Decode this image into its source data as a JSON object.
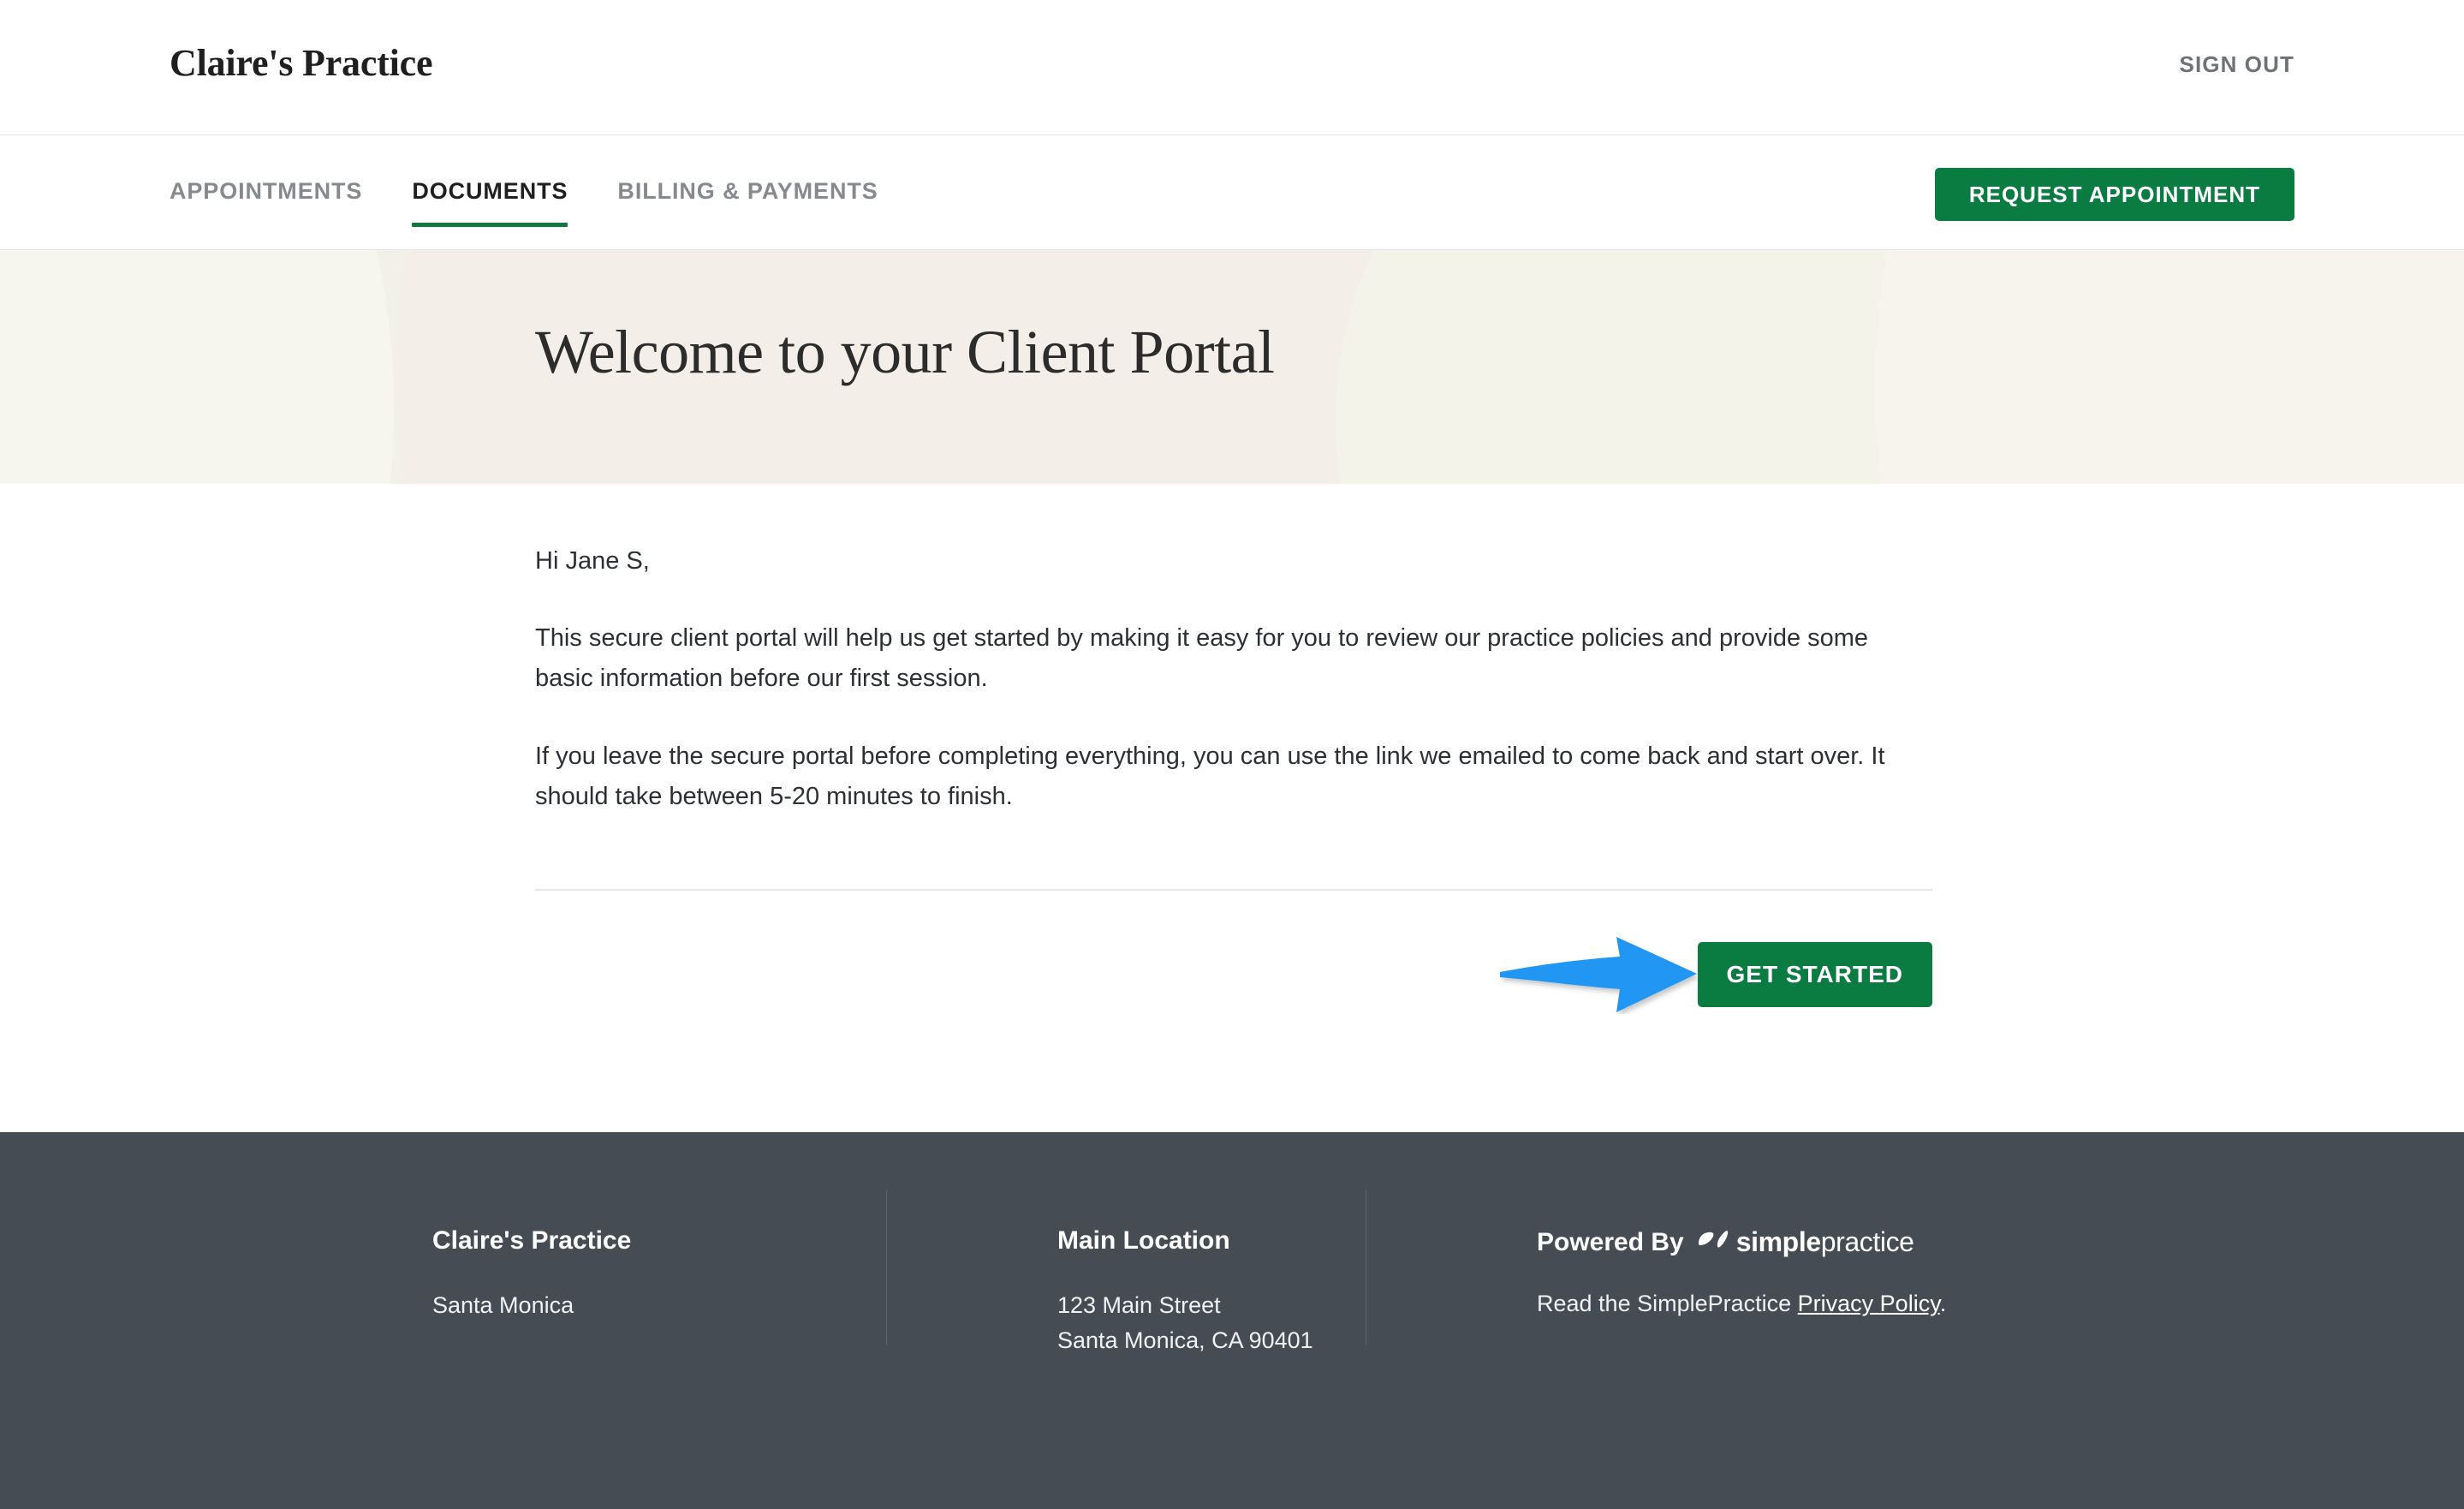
{
  "header": {
    "brand": "Claire's Practice",
    "sign_out_label": "SIGN OUT"
  },
  "nav": {
    "items": [
      {
        "label": "APPOINTMENTS",
        "active": false
      },
      {
        "label": "DOCUMENTS",
        "active": true
      },
      {
        "label": "BILLING & PAYMENTS",
        "active": false
      }
    ],
    "request_appointment_label": "REQUEST APPOINTMENT"
  },
  "hero": {
    "title": "Welcome to your Client Portal",
    "background_color": "#F2F1E7"
  },
  "main": {
    "greeting": "Hi Jane S,",
    "paragraph_1": "This secure client portal will help us get started by making it easy for you to review our practice policies and provide some basic information before our first session.",
    "paragraph_2": "If you leave the secure portal before completing everything, you can use the link we emailed to come back and start over. It should take between 5-20 minutes to finish.",
    "get_started_label": "GET STARTED"
  },
  "annotation": {
    "arrow_color": "#2196F3",
    "points_at": "GET STARTED"
  },
  "footer": {
    "background_color": "#464C54",
    "practice": {
      "heading": "Claire's Practice",
      "line_1": "Santa Monica"
    },
    "location": {
      "heading": "Main Location",
      "line_1": "123 Main Street",
      "line_2": "Santa Monica, CA 90401"
    },
    "powered": {
      "label": "Powered By",
      "logo_bold": "simple",
      "logo_light": "practice",
      "privacy_prefix": "Read the SimplePractice ",
      "privacy_link": "Privacy Policy",
      "privacy_suffix": "."
    }
  },
  "colors": {
    "brand_green": "#0A7C42",
    "accent_underline": "#11793F",
    "text_dark": "#2C2F33",
    "text_muted": "#86898D"
  }
}
